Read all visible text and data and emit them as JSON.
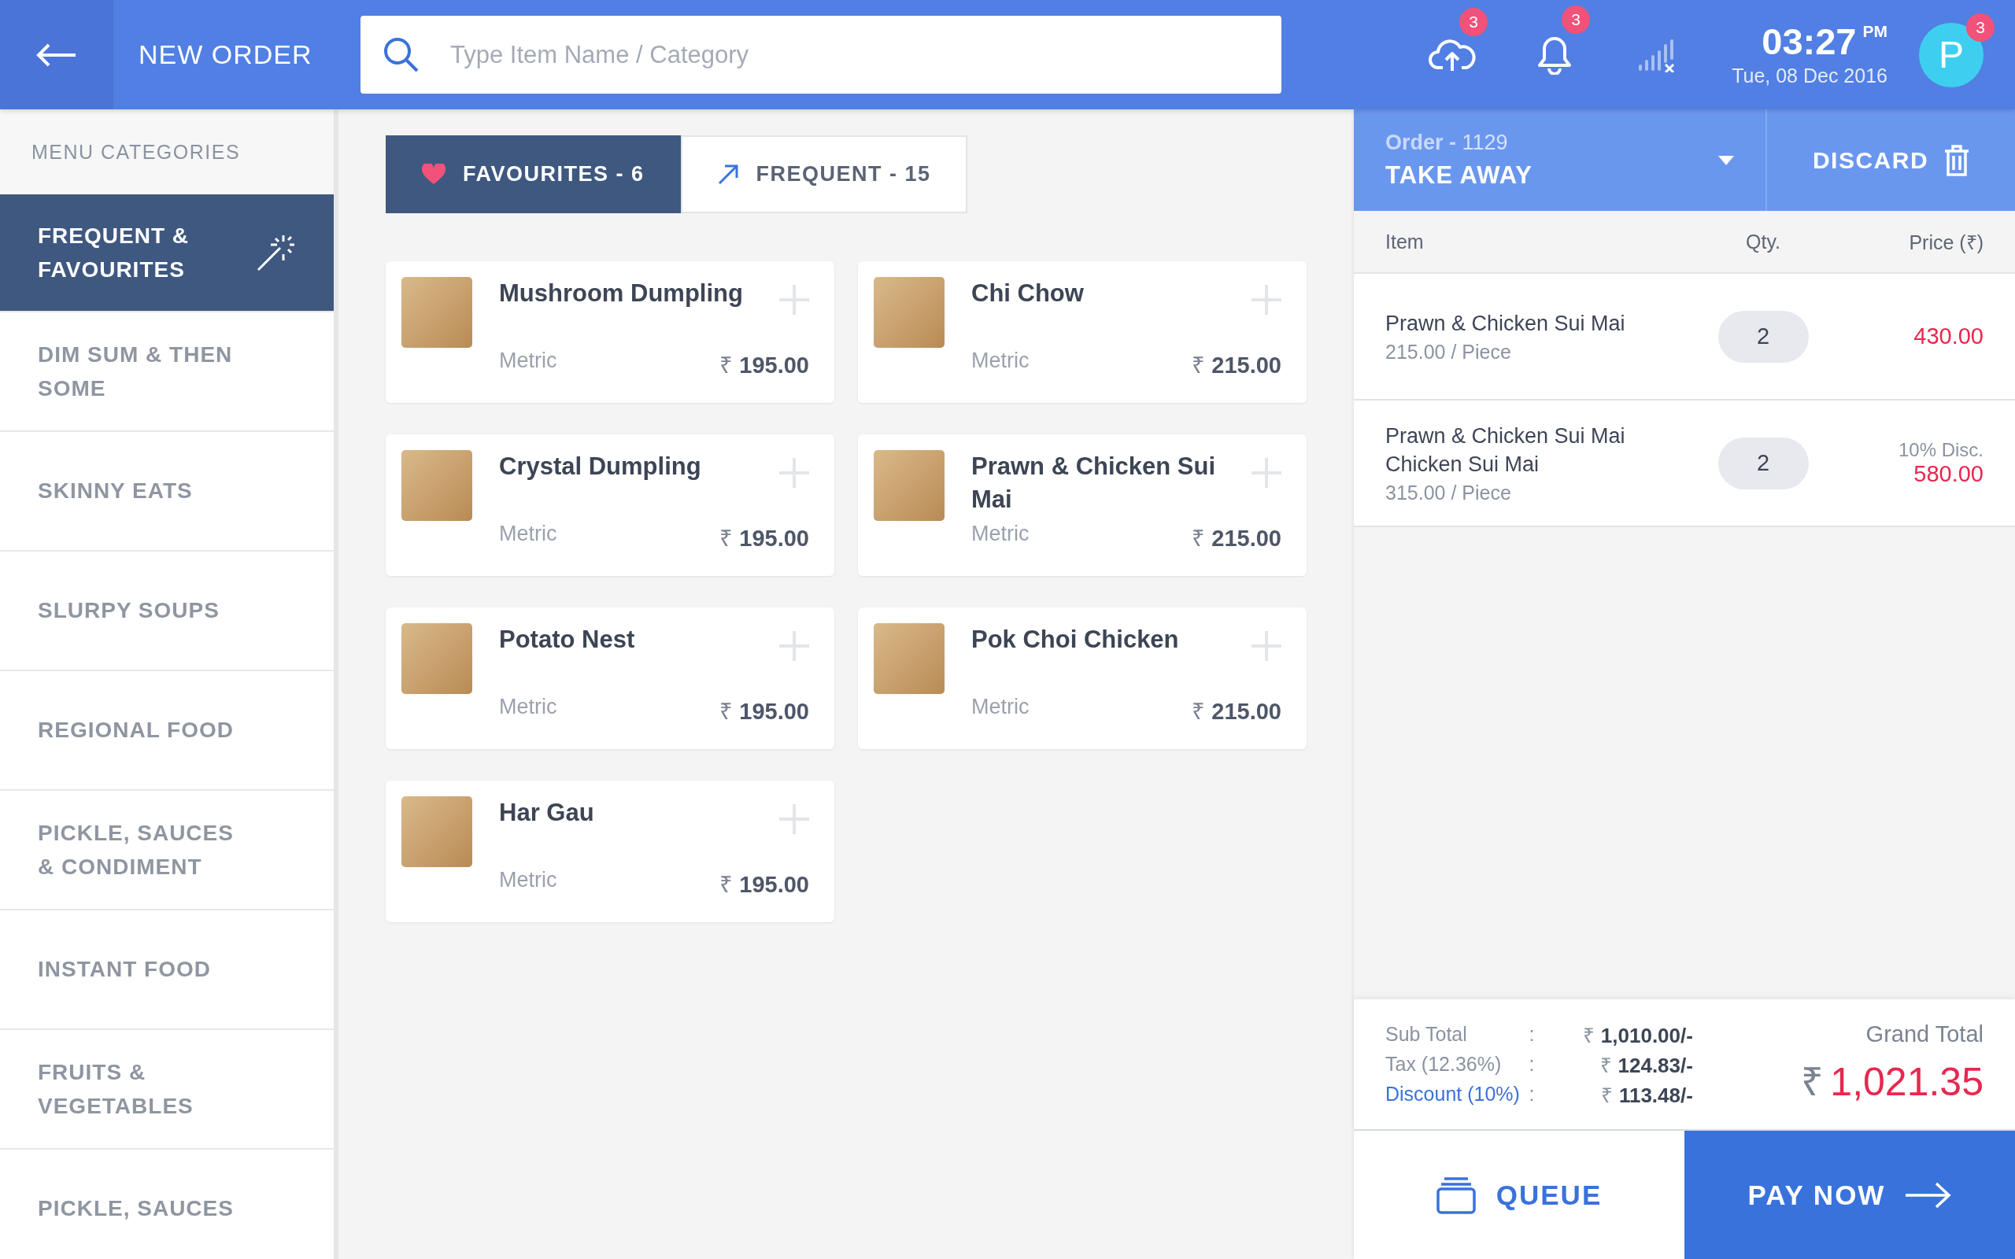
{
  "header": {
    "title": "NEW ORDER",
    "search": {
      "placeholder": "Type Item Name / Category"
    },
    "upload_badge": "3",
    "notification_badge": "3",
    "time": "03:27",
    "meridiem": "PM",
    "date": "Tue, 08 Dec 2016",
    "avatar": {
      "initial": "P",
      "badge": "3"
    }
  },
  "sidebar": {
    "heading": "MENU CATEGORIES",
    "items": [
      {
        "label": "FREQUENT & FAVOURITES",
        "selected": true
      },
      {
        "label": "DIM SUM & THEN SOME",
        "selected": false
      },
      {
        "label": "SKINNY EATS",
        "selected": false
      },
      {
        "label": "SLURPY SOUPS",
        "selected": false
      },
      {
        "label": "REGIONAL FOOD",
        "selected": false
      },
      {
        "label": "PICKLE, SAUCES & CONDIMENT",
        "selected": false
      },
      {
        "label": "INSTANT FOOD",
        "selected": false
      },
      {
        "label": "FRUITS & VEGETABLES",
        "selected": false
      },
      {
        "label": "PICKLE, SAUCES",
        "selected": false
      }
    ]
  },
  "tabs": [
    {
      "label": "FAVOURITES - 6",
      "kind": "heart",
      "selected": true
    },
    {
      "label": "FREQUENT - 15",
      "kind": "trend",
      "selected": false
    }
  ],
  "menu_items": [
    {
      "name": "Mushroom Dumpling",
      "unit": "Metric",
      "currency": "₹",
      "price": "195.00"
    },
    {
      "name": "Chi Chow",
      "unit": "Metric",
      "currency": "₹",
      "price": "215.00"
    },
    {
      "name": "Crystal Dumpling",
      "unit": "Metric",
      "currency": "₹",
      "price": "195.00"
    },
    {
      "name": "Prawn & Chicken Sui Mai",
      "unit": "Metric",
      "currency": "₹",
      "price": "215.00"
    },
    {
      "name": "Potato Nest",
      "unit": "Metric",
      "currency": "₹",
      "price": "195.00"
    },
    {
      "name": "Pok Choi Chicken",
      "unit": "Metric",
      "currency": "₹",
      "price": "215.00"
    },
    {
      "name": "Har Gau",
      "unit": "Metric",
      "currency": "₹",
      "price": "195.00"
    }
  ],
  "order": {
    "label": "Order -",
    "number": "1129",
    "type": "TAKE AWAY",
    "discard": "DISCARD",
    "columns": [
      "Item",
      "Qty.",
      "Price (₹)"
    ],
    "lines": [
      {
        "name": "Prawn & Chicken Sui Mai",
        "rate": "215.00 / Piece",
        "qty": "2",
        "price": "430.00"
      },
      {
        "name": "Prawn & Chicken Sui Mai Chicken Sui Mai",
        "rate": "315.00 / Piece",
        "qty": "2",
        "discount": "10% Disc.",
        "price": "580.00"
      }
    ],
    "summary": [
      {
        "label": "Sub Total",
        "kind": "plain",
        "sep": ":",
        "currency": "₹",
        "value": "1,010.00/-"
      },
      {
        "label": "Tax (12.36%)",
        "kind": "plain",
        "sep": ":",
        "currency": "₹",
        "value": "124.83/-"
      },
      {
        "label": "Discount (10%)",
        "kind": "link",
        "sep": ":",
        "currency": "₹",
        "value": "113.48/-"
      }
    ],
    "grand_total": {
      "label": "Grand Total",
      "currency": "₹",
      "value": "1,021.35"
    },
    "queue": "QUEUE",
    "pay_now": "PAY NOW"
  }
}
